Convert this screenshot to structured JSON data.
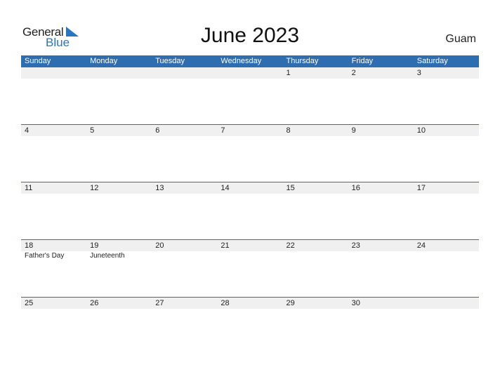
{
  "logo": {
    "word1": "General",
    "word2": "Blue"
  },
  "title": "June 2023",
  "country": "Guam",
  "colors": {
    "header": "#2e6eb0",
    "accent": "#2a74c0",
    "row_bg": "#f0f0f0"
  },
  "days": [
    "Sunday",
    "Monday",
    "Tuesday",
    "Wednesday",
    "Thursday",
    "Friday",
    "Saturday"
  ],
  "weeks": [
    {
      "dates": [
        "",
        "",
        "",
        "",
        "1",
        "2",
        "3"
      ],
      "events": [
        "",
        "",
        "",
        "",
        "",
        "",
        ""
      ]
    },
    {
      "dates": [
        "4",
        "5",
        "6",
        "7",
        "8",
        "9",
        "10"
      ],
      "events": [
        "",
        "",
        "",
        "",
        "",
        "",
        ""
      ]
    },
    {
      "dates": [
        "11",
        "12",
        "13",
        "14",
        "15",
        "16",
        "17"
      ],
      "events": [
        "",
        "",
        "",
        "",
        "",
        "",
        ""
      ]
    },
    {
      "dates": [
        "18",
        "19",
        "20",
        "21",
        "22",
        "23",
        "24"
      ],
      "events": [
        "Father's Day",
        "Juneteenth",
        "",
        "",
        "",
        "",
        ""
      ]
    },
    {
      "dates": [
        "25",
        "26",
        "27",
        "28",
        "29",
        "30",
        ""
      ],
      "events": [
        "",
        "",
        "",
        "",
        "",
        "",
        ""
      ]
    }
  ]
}
